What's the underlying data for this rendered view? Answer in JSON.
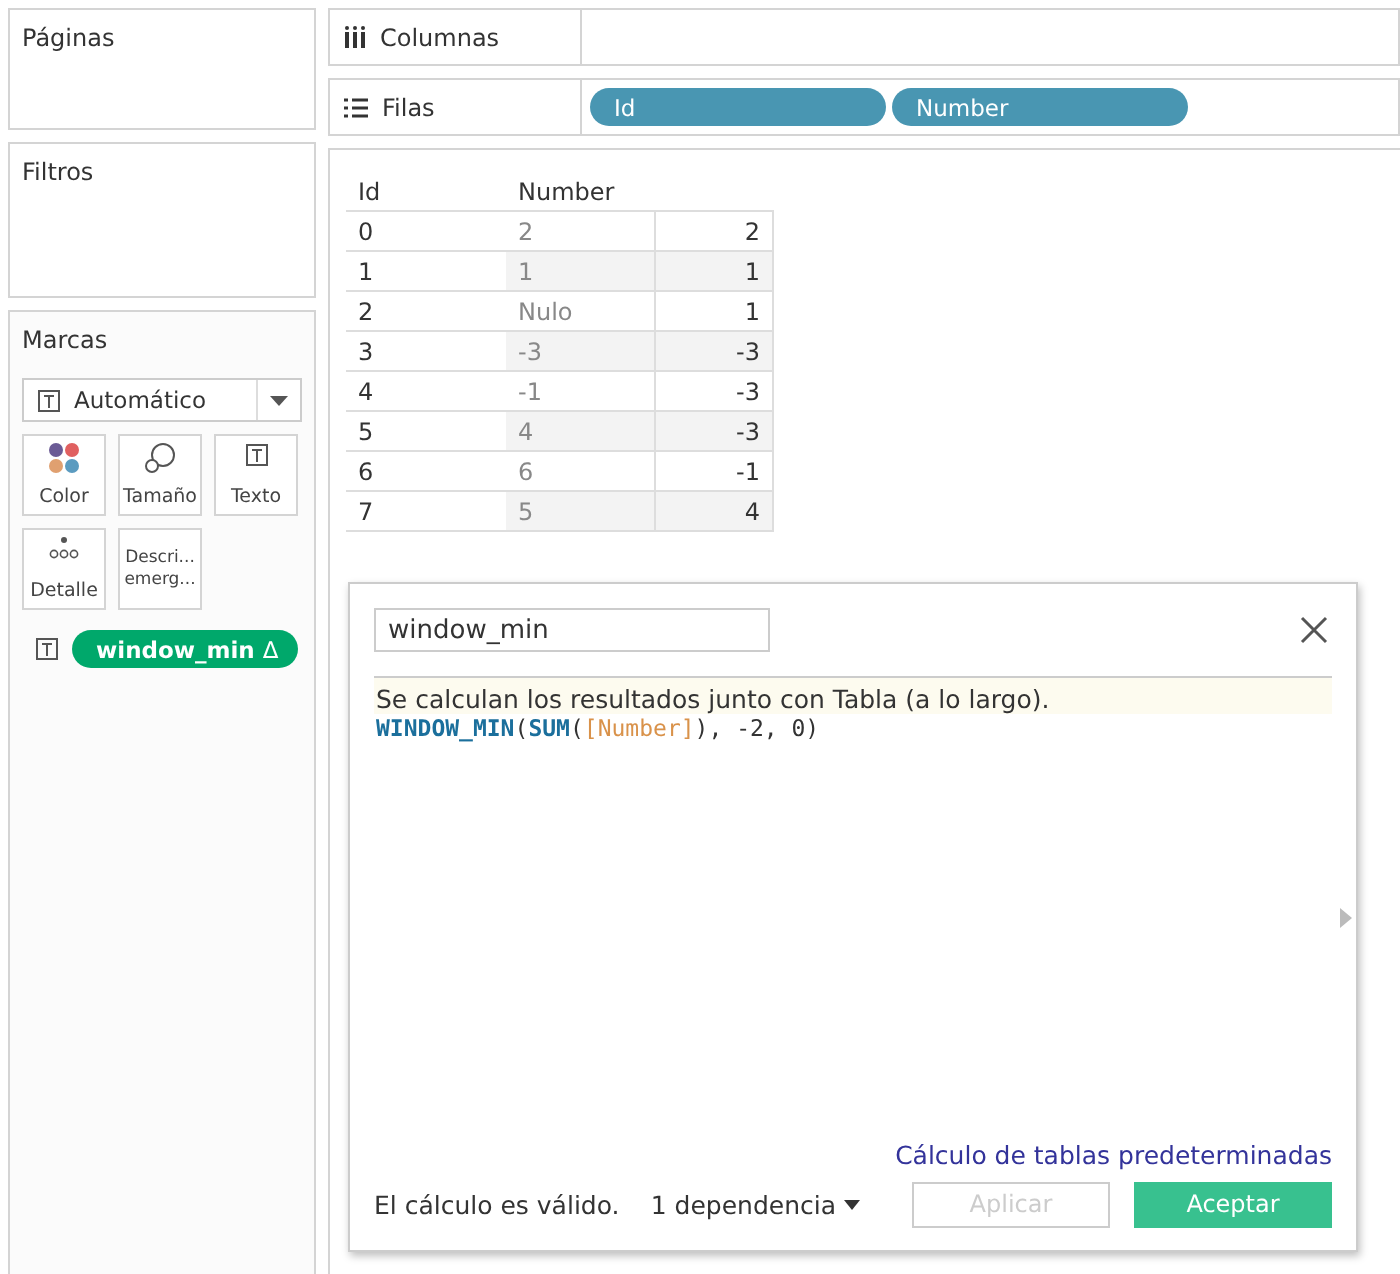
{
  "left": {
    "pages": {
      "title": "Páginas"
    },
    "filters": {
      "title": "Filtros"
    },
    "marks": {
      "title": "Marcas",
      "mark_type": "Automático",
      "cards": [
        {
          "kind": "color",
          "label": "Color"
        },
        {
          "kind": "size",
          "label": "Tamaño"
        },
        {
          "kind": "text",
          "label": "Texto"
        },
        {
          "kind": "detail",
          "label": "Detalle"
        },
        {
          "kind": "tooltip",
          "label": "Descri... emerg..."
        }
      ],
      "fields": [
        {
          "kind": "continuous",
          "label": "window_min",
          "delta": "Δ"
        }
      ]
    }
  },
  "shelves": [
    {
      "kind": "columns",
      "label": "Columnas"
    },
    {
      "kind": "rows",
      "label": "Filas",
      "pills": [
        {
          "kind": "discrete",
          "label": "Id"
        },
        {
          "kind": "discrete",
          "label": "Number"
        }
      ]
    }
  ],
  "table": {
    "columns": [
      "Id",
      "Number"
    ],
    "rows": [
      [
        "0",
        "2",
        "2"
      ],
      [
        "1",
        "1",
        "1"
      ],
      [
        "2",
        "Nulo",
        "1"
      ],
      [
        "3",
        "-3",
        "-3"
      ],
      [
        "4",
        "-1",
        "-3"
      ],
      [
        "5",
        "4",
        "-3"
      ],
      [
        "6",
        "6",
        "-1"
      ],
      [
        "7",
        "5",
        "4"
      ]
    ]
  },
  "dialog": {
    "name": "window_min",
    "info": "Se calculan los resultados junto con Tabla (a lo largo).",
    "formula": [
      {
        "kind": "function",
        "text": "WINDOW_MIN"
      },
      {
        "kind": "plain",
        "text": "("
      },
      {
        "kind": "function",
        "text": "SUM"
      },
      {
        "kind": "plain",
        "text": "("
      },
      {
        "kind": "field",
        "text": "[Number]"
      },
      {
        "kind": "plain",
        "text": "), -2, 0)"
      }
    ],
    "link": "Cálculo de tablas predeterminadas",
    "status": "El cálculo es válido.",
    "dependencies": "1 dependencia",
    "buttons": [
      {
        "kind": "secondary",
        "label": "Aplicar",
        "disabled": true
      },
      {
        "kind": "primary",
        "label": "Aceptar",
        "disabled": false
      }
    ]
  }
}
